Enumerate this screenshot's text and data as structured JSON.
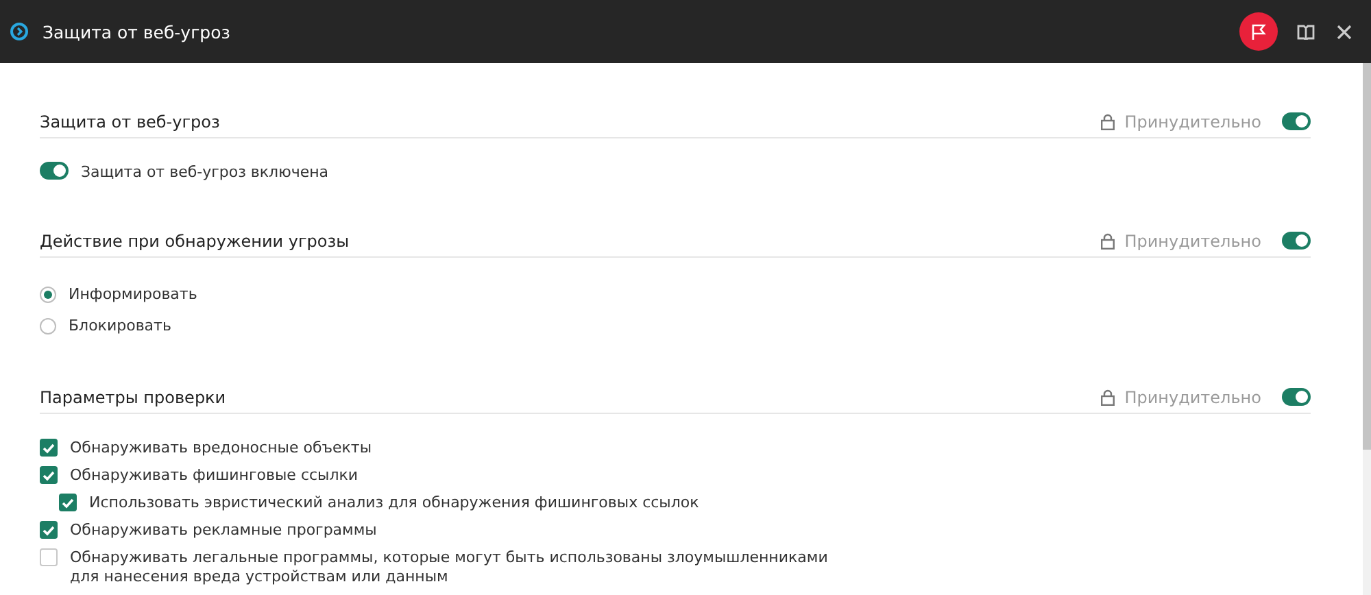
{
  "window": {
    "title": "Защита от веб-угроз"
  },
  "sections": [
    {
      "title": "Защита от веб-угроз",
      "enforced_label": "Принудительно",
      "enforced": true,
      "items": [
        {
          "kind": "toggle",
          "label": "Защита от веб-угроз включена",
          "on": true
        }
      ]
    },
    {
      "title": "Действие при обнаружении угрозы",
      "enforced_label": "Принудительно",
      "enforced": true,
      "items": [
        {
          "kind": "radio",
          "label": "Информировать",
          "selected": true
        },
        {
          "kind": "radio",
          "label": "Блокировать",
          "selected": false
        }
      ]
    },
    {
      "title": "Параметры проверки",
      "enforced_label": "Принудительно",
      "enforced": true,
      "items": [
        {
          "kind": "checkbox",
          "label": "Обнаруживать вредоносные объекты",
          "checked": true
        },
        {
          "kind": "checkbox",
          "label": "Обнаруживать фишинговые ссылки",
          "checked": true,
          "children": [
            {
              "kind": "checkbox",
              "label": "Использовать эвристический анализ для обнаружения фишинговых ссылок",
              "checked": true
            }
          ]
        },
        {
          "kind": "checkbox",
          "label": "Обнаруживать рекламные программы",
          "checked": true
        },
        {
          "kind": "checkbox",
          "label": "Обнаруживать легальные программы, которые могут быть использованы злоумышленниками для нанесения вреда устройствам или данным",
          "checked": false
        }
      ]
    }
  ]
}
